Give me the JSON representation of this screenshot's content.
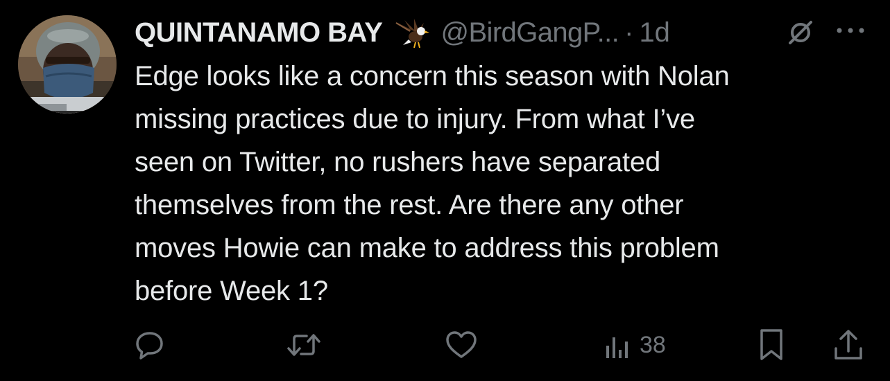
{
  "user": {
    "display_name": "QUINTANAMO BAY",
    "display_name_emoji": "eagle-emoji",
    "handle": "@BirdGangP...",
    "separator": "·",
    "time": "1d"
  },
  "tweet": {
    "lines": [
      "Edge looks like a concern this season with Nolan",
      "missing practices due to injury. From what I’ve",
      "seen on Twitter, no rushers have separated",
      "themselves from the rest. Are there any other",
      "moves Howie can make to address this problem",
      "before Week 1?"
    ]
  },
  "actions": {
    "reply_icon": "reply-icon",
    "retweet_icon": "retweet-icon",
    "like_icon": "heart-icon",
    "views_icon": "views-icon",
    "views_count": "38",
    "bookmark_icon": "bookmark-icon",
    "share_icon": "share-icon"
  },
  "header_icons": {
    "grok": "grok-icon",
    "more": "more-icon"
  },
  "colors": {
    "background": "#000000",
    "primary_text": "#e7e9ea",
    "secondary_text": "#71767b"
  }
}
